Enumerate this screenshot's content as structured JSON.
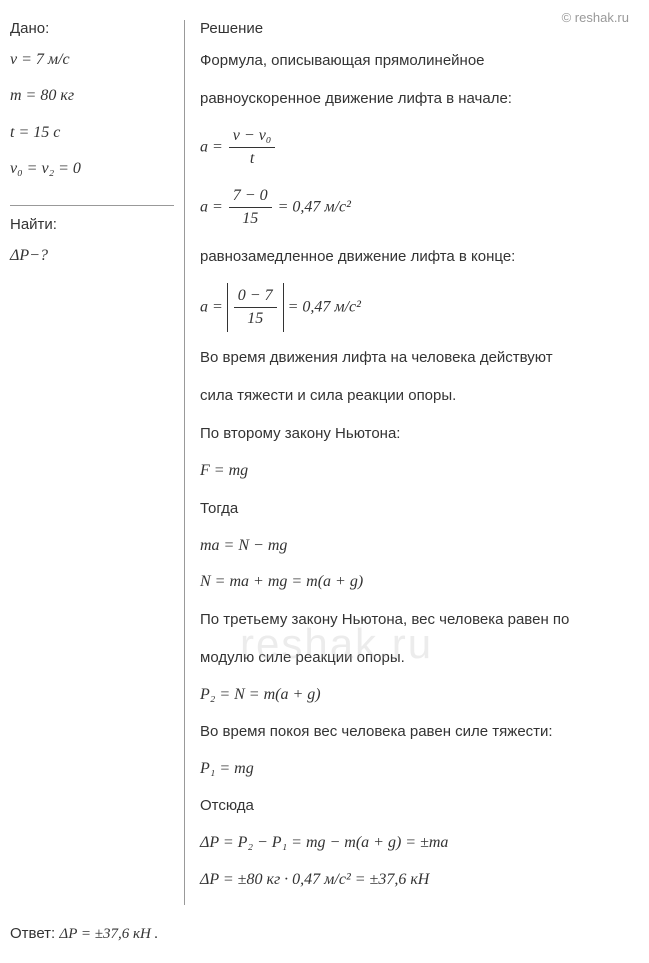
{
  "watermark": "© reshak.ru",
  "watermark_center": "reshak.ru",
  "given": {
    "title": "Дано:",
    "lines": [
      "v = 7 м/с",
      "m = 80 кг",
      "t = 15 с",
      "v₀ = v₂ = 0"
    ]
  },
  "find": {
    "title": "Найти:",
    "line": "ΔP−?"
  },
  "solution": {
    "title": "Решение",
    "t1": "Формула, описывающая прямолинейное",
    "t2": "равноускоренное движение лифта в начале:",
    "f1_lhs": "a =",
    "f1_num": "v − v₀",
    "f1_den": "t",
    "f2_lhs": "a =",
    "f2_num": "7 − 0",
    "f2_den": "15",
    "f2_rhs": "= 0,47 м/с²",
    "t3": "равнозамедленное движение лифта в конце:",
    "f3_lhs": "a =",
    "f3_num": "0 − 7",
    "f3_den": "15",
    "f3_rhs": "= 0,47 м/с²",
    "t4": "Во время движения лифта на человека действуют",
    "t5": "сила тяжести и сила реакции опоры.",
    "t6": "По второму закону Ньютона:",
    "f4": "F = mg",
    "t7": "Тогда",
    "f5": "ma = N − mg",
    "f6": "N = ma + mg = m(a + g)",
    "t8": "По третьему закону Ньютона, вес человека равен по",
    "t9": "модулю силе реакции опоры.",
    "f7": "P₂ = N = m(a + g)",
    "t10": "Во время покоя вес человека равен силе тяжести:",
    "f8": "P₁ = mg",
    "t11": "Отсюда",
    "f9": "ΔP = P₂ − P₁ = mg − m(a + g) = ±ma",
    "f10": "ΔP = ±80 кг · 0,47 м/с² = ±37,6 кН"
  },
  "answer": {
    "label": "Ответ:",
    "value": "ΔP = ±37,6 кН ."
  }
}
